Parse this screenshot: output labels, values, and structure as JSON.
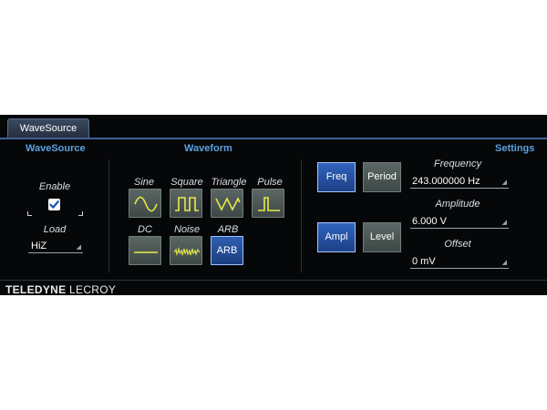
{
  "tab": {
    "label": "WaveSource"
  },
  "sections": {
    "wavesource": "WaveSource",
    "waveform": "Waveform",
    "settings": "Settings"
  },
  "wavesource": {
    "enable_label": "Enable",
    "enable_checked": true,
    "load_label": "Load",
    "load_value": "HiZ"
  },
  "waveform": {
    "sine": "Sine",
    "square": "Square",
    "triangle": "Triangle",
    "pulse": "Pulse",
    "dc": "DC",
    "noise": "Noise",
    "arb": "ARB",
    "arb_button": "ARB",
    "selected": "ARB",
    "icons": [
      "sine-wave-icon",
      "square-wave-icon",
      "triangle-wave-icon",
      "pulse-wave-icon",
      "dc-line-icon",
      "noise-wave-icon"
    ]
  },
  "settings": {
    "freq_button": "Freq",
    "period_button": "Period",
    "ampl_button": "Ampl",
    "level_button": "Level",
    "frequency_label": "Frequency",
    "frequency_value": "243.000000 Hz",
    "amplitude_label": "Amplitude",
    "amplitude_value": "6.000 V",
    "offset_label": "Offset",
    "offset_value": "0 mV"
  },
  "footer": {
    "brand_bold": "TELEDYNE",
    "brand_rest": " LECROY"
  },
  "colors": {
    "panel_bg": "#060708",
    "section_title": "#5aa1e0",
    "active_button": "#2f5fb0",
    "inactive_button": "#4e5a57",
    "waveform_icon": "#e6ea4a"
  }
}
